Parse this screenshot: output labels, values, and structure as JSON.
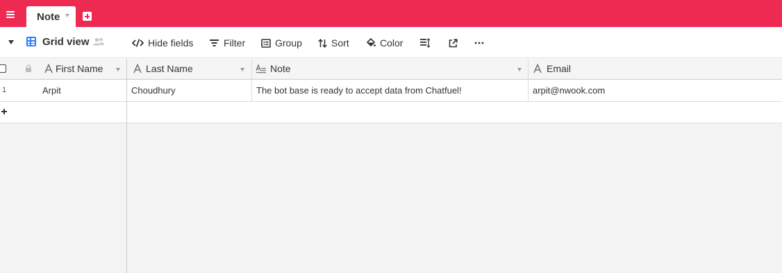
{
  "app": {
    "tabs": [
      {
        "label": "Note",
        "active": true
      }
    ],
    "accent_color": "#ee2a53"
  },
  "toolbar": {
    "view_name": "Grid view",
    "buttons": {
      "hide_fields": "Hide fields",
      "filter": "Filter",
      "group": "Group",
      "sort": "Sort",
      "color": "Color"
    },
    "icons": {
      "view_switcher": "chevron-down-icon",
      "view_type": "grid-icon",
      "collaborators": "people-icon",
      "row_height": "row-height-icon",
      "share": "share-icon",
      "more": "more-icon"
    }
  },
  "grid": {
    "columns": [
      {
        "name": "First Name",
        "type": "single-line-text"
      },
      {
        "name": "Last Name",
        "type": "single-line-text"
      },
      {
        "name": "Note",
        "type": "long-text"
      },
      {
        "name": "Email",
        "type": "single-line-text"
      }
    ],
    "rows": [
      {
        "number": "1",
        "cells": [
          "Arpit",
          "Choudhury",
          "The bot base is ready to accept data from Chatfuel!",
          "arpit@nwook.com"
        ]
      }
    ]
  }
}
